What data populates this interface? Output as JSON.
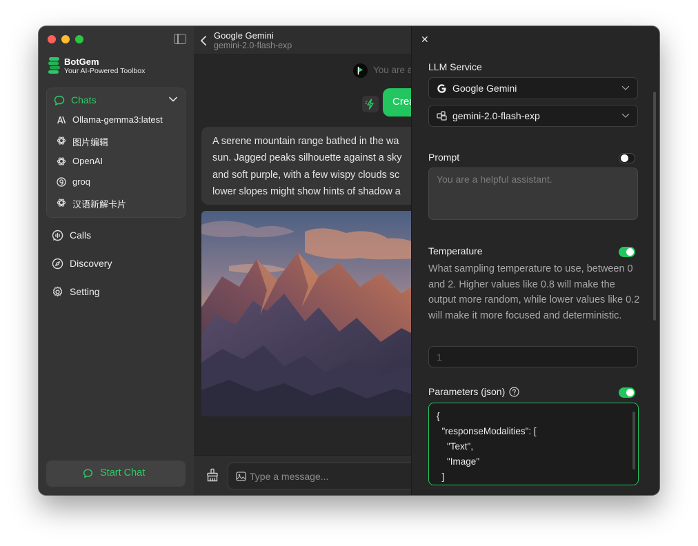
{
  "app": {
    "name": "BotGem",
    "tagline": "Your AI-Powered Toolbox"
  },
  "sidebar": {
    "chats_label": "Chats",
    "chats": [
      {
        "label": "Ollama-gemma3:latest",
        "icon": "anthropic-icon"
      },
      {
        "label": "图片编辑",
        "icon": "openai-icon"
      },
      {
        "label": "OpenAI",
        "icon": "openai-icon"
      },
      {
        "label": "groq",
        "icon": "groq-icon"
      },
      {
        "label": "汉语新解卡片",
        "icon": "openai-icon"
      }
    ],
    "nav": [
      {
        "label": "Calls",
        "icon": "phone-wave-icon"
      },
      {
        "label": "Discovery",
        "icon": "compass-icon"
      },
      {
        "label": "Setting",
        "icon": "gear-icon"
      }
    ],
    "start_chat_label": "Start Chat"
  },
  "chat": {
    "title": "Google Gemini",
    "model": "gemini-2.0-flash-exp",
    "system_preview": "You are a helpful assistant.",
    "user_message": "Crea",
    "ai_text_lines": [
      "A serene mountain range bathed in the wa",
      "sun. Jagged peaks silhouette against a sky",
      "and soft purple, with a few wispy clouds sc",
      "lower slopes might show hints of shadow a"
    ],
    "input_placeholder": "Type a message..."
  },
  "settings": {
    "llm_service_label": "LLM Service",
    "service_value": "Google Gemini",
    "model_value": "gemini-2.0-flash-exp",
    "prompt_label": "Prompt",
    "prompt_enabled": false,
    "prompt_placeholder": "You are a helpful assistant.",
    "temperature_label": "Temperature",
    "temperature_enabled": true,
    "temperature_description": "What sampling temperature to use, between 0 and 2. Higher values like 0.8 will make the output more random, while lower values like 0.2 will make it more focused and deterministic.",
    "temperature_placeholder": "1",
    "parameters_label": "Parameters (json)",
    "parameters_enabled": true,
    "parameters_json": "{\n  \"responseModalities\": [\n    \"Text\",\n    \"Image\"\n  ]"
  },
  "colors": {
    "accent": "#22c55e",
    "accent_text": "#2ecc63",
    "sidebar_bg": "#343434",
    "main_bg": "#262626"
  }
}
